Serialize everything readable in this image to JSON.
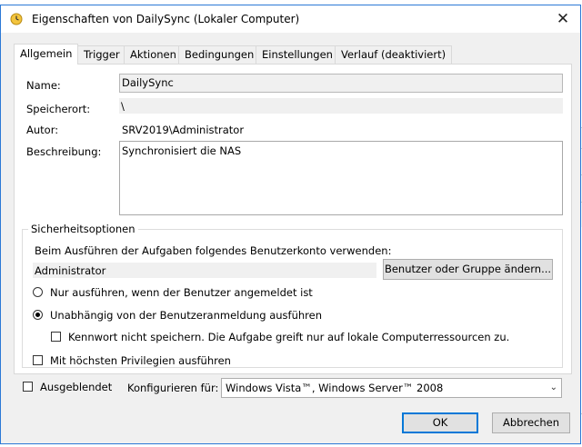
{
  "window": {
    "title": "Eigenschaften von DailySync (Lokaler Computer)"
  },
  "tabs": [
    {
      "label": "Allgemein",
      "active": true
    },
    {
      "label": "Trigger"
    },
    {
      "label": "Aktionen"
    },
    {
      "label": "Bedingungen"
    },
    {
      "label": "Einstellungen"
    },
    {
      "label": "Verlauf (deaktiviert)"
    }
  ],
  "general": {
    "name_label": "Name:",
    "name_value": "DailySync",
    "location_label": "Speicherort:",
    "location_value": "\\",
    "author_label": "Autor:",
    "author_value": "SRV2019\\Administrator",
    "description_label": "Beschreibung:",
    "description_value": "Synchronisiert die NAS"
  },
  "security": {
    "group_title": "Sicherheitsoptionen",
    "account_prompt": "Beim Ausführen der Aufgaben folgendes Benutzerkonto verwenden:",
    "account_value": "Administrator",
    "change_button": "Benutzer oder Gruppe ändern...",
    "radio_logged_on": "Nur ausführen, wenn der Benutzer angemeldet ist",
    "radio_independent": "Unabhängig von der Benutzeranmeldung ausführen",
    "no_password": "Kennwort nicht speichern. Die Aufgabe greift nur auf lokale Computerressourcen zu.",
    "highest_privileges": "Mit höchsten Privilegien ausführen"
  },
  "bottom": {
    "hidden_label": "Ausgeblendet",
    "configure_label": "Konfigurieren für:",
    "configure_value": "Windows Vista™, Windows Server™ 2008"
  },
  "buttons": {
    "ok": "OK",
    "cancel": "Abbrechen"
  },
  "background_fragments": [
    "k",
    "r",
    "Ei"
  ]
}
